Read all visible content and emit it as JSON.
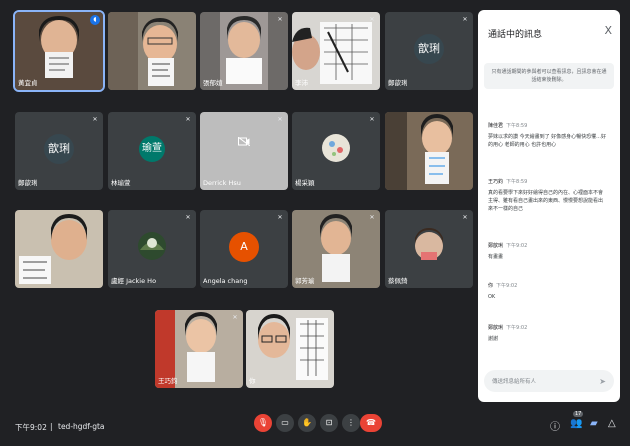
{
  "tiles": [
    {
      "name": "黃宜貞",
      "avatar_text": "",
      "speaking": true
    },
    {
      "name": "",
      "avatar_text": ""
    },
    {
      "name": "張郁媗",
      "avatar_text": ""
    },
    {
      "name": "李沛",
      "avatar_text": ""
    },
    {
      "name": "鄭歆琍",
      "avatar_text": "歆琍",
      "avatar_color": "#37474f"
    },
    {
      "name": "鄭歆琍",
      "avatar_text": "歆琍",
      "avatar_color": "#37474f"
    },
    {
      "name": "林瑜萱",
      "avatar_text": "瑜萱",
      "avatar_color": "#00796b"
    },
    {
      "name": "Derrick Hsu",
      "avatar_text": ""
    },
    {
      "name": "楊采穎",
      "avatar_text": ""
    },
    {
      "name": "",
      "avatar_text": ""
    },
    {
      "name": "",
      "avatar_text": ""
    },
    {
      "name": "盧經 Jackie Ho",
      "avatar_text": ""
    },
    {
      "name": "Angela chang",
      "avatar_text": "A",
      "avatar_color": "#e65100"
    },
    {
      "name": "郭芳瑜",
      "avatar_text": ""
    },
    {
      "name": "蔡佩錡",
      "avatar_text": ""
    },
    {
      "name": "王巧鈞",
      "avatar_text": ""
    },
    {
      "name": "你",
      "avatar_text": ""
    }
  ],
  "chat": {
    "title": "通話中的訊息",
    "close": "X",
    "notice": "只有通話期間的參與者可以查看訊息，且訊息會在通話結束後刪除。",
    "messages": [
      {
        "sender": "陳佳君",
        "time": "下午8:59",
        "text": "夢妹以求的讚 今天繪畫到了 好像感身心暢快恐懼...好的用心 老師的用心 也許也用心"
      },
      {
        "sender": "王巧鈞",
        "time": "下午8:59",
        "text": "真的看要學下來好好繪得自己的內在、心裡面本不會主得、雖有看自己畫出來的東西、慢慢要想說能看出來不一樣的自己"
      },
      {
        "sender": "鄭歆琍",
        "time": "下午9:02",
        "text": "有畫畫"
      },
      {
        "sender": "你",
        "time": "下午9:02",
        "text": "OK"
      },
      {
        "sender": "鄭歆琍",
        "time": "下午9:02",
        "text": "謝謝"
      }
    ],
    "input_placeholder": "傳送訊息給所有人"
  },
  "bottom": {
    "time": "下午9:02",
    "separator": "|",
    "meeting_code": "ted-hgdf-gta",
    "participants_badge": "17"
  }
}
